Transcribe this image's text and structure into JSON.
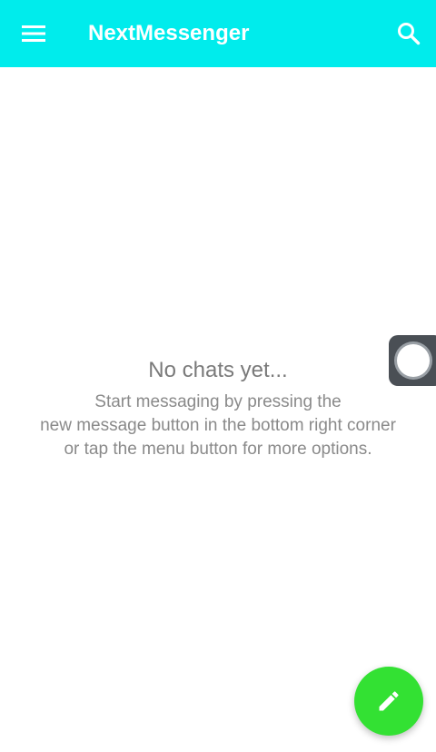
{
  "colors": {
    "app_bar": "#00ECEC",
    "fab": "#33E133",
    "title_text": "#FFFFFF"
  },
  "app_bar": {
    "title": "NextMessenger",
    "menu_icon": "hamburger-menu-icon",
    "search_icon": "search-icon"
  },
  "empty_state": {
    "title": "No chats yet...",
    "lines": [
      "Start messaging by pressing the",
      "new message button in the bottom right corner",
      "or tap the menu button for more options."
    ]
  },
  "assistive_touch": {
    "icon": "assistive-touch-icon"
  },
  "fab": {
    "icon": "pencil-icon"
  }
}
